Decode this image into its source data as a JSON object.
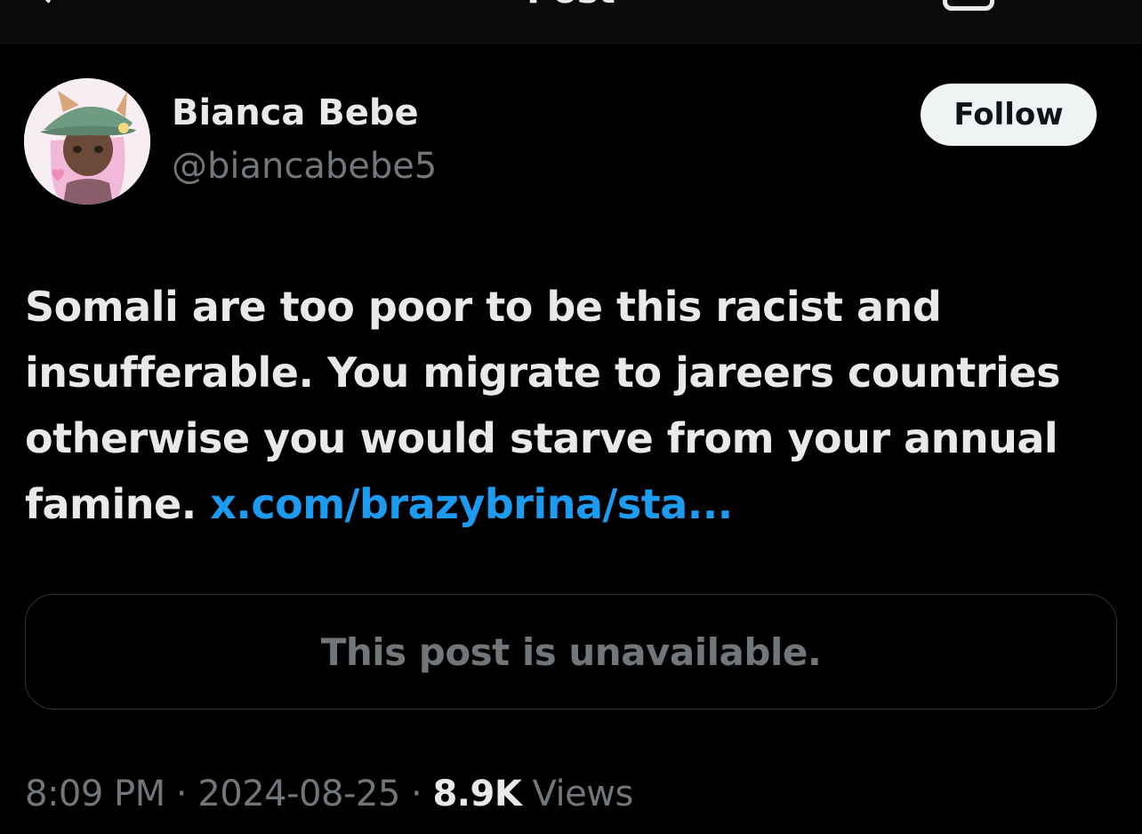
{
  "header": {
    "title": "Post",
    "back_icon": "arrow-left-icon",
    "action_icon": "reader-icon"
  },
  "author": {
    "display_name": "Bianca Bebe",
    "handle": "@biancabebe5",
    "avatar_icon": "avatar-illustration"
  },
  "follow": {
    "label": "Follow"
  },
  "post": {
    "text": "Somali are too poor to be this racist and insufferable. You migrate to jareers countries otherwise you would starve from your annual famine. ",
    "link_text": "x.com/brazybrina/sta..."
  },
  "quote": {
    "unavailable_text": "This post is unavailable."
  },
  "meta": {
    "time": "8:09 PM",
    "separator1": " · ",
    "date": "2024-08-25",
    "separator2": " · ",
    "views_count": "8.9K",
    "views_label": " Views"
  },
  "colors": {
    "background": "#000000",
    "text_primary": "#e7e9ea",
    "text_secondary": "#71767b",
    "link": "#1d9bf0",
    "follow_bg": "#eff3f4",
    "border": "#2f3336"
  }
}
